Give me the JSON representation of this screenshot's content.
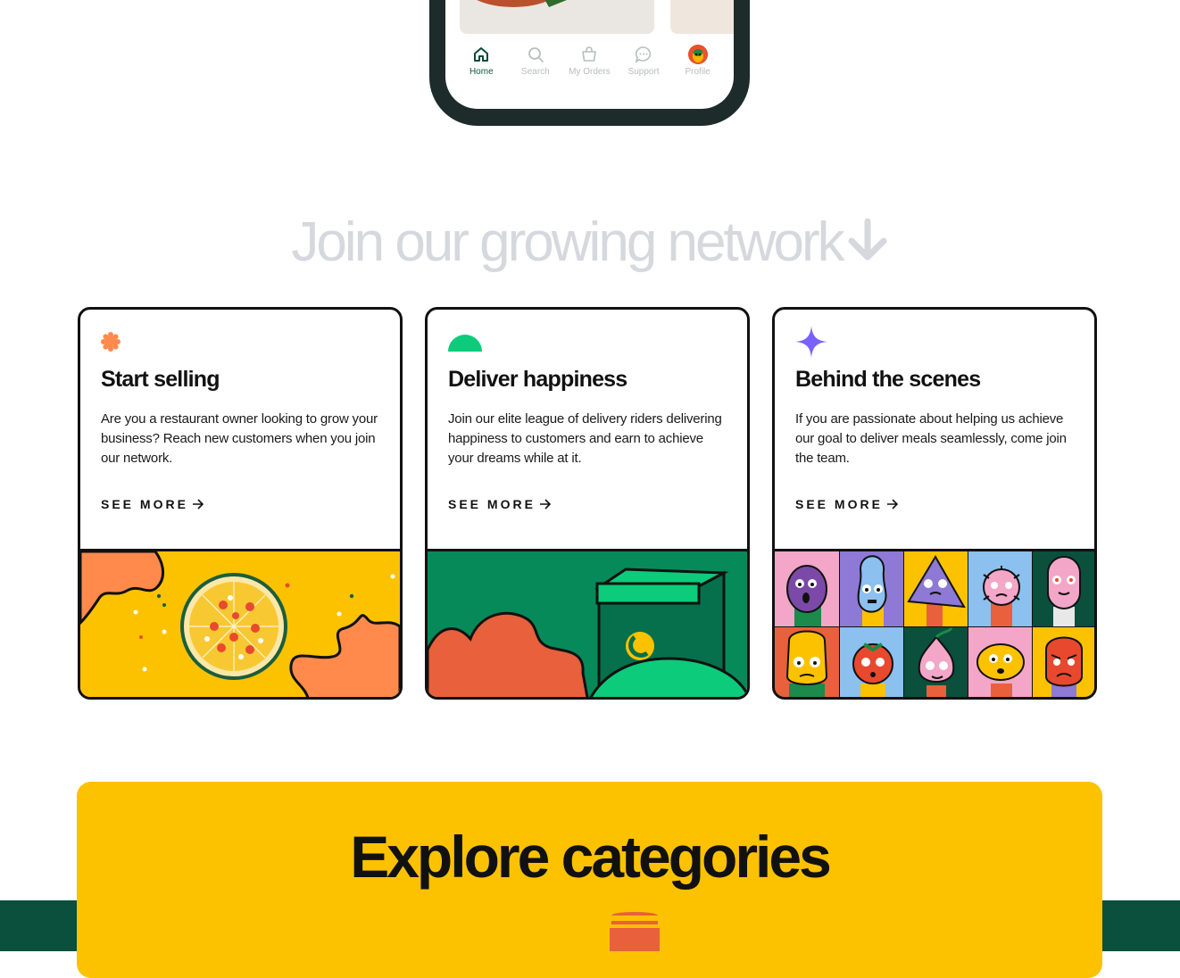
{
  "phone": {
    "nav": [
      {
        "label": "Home",
        "icon": "home-icon",
        "active": true
      },
      {
        "label": "Search",
        "icon": "search-icon",
        "active": false
      },
      {
        "label": "My Orders",
        "icon": "basket-icon",
        "active": false
      },
      {
        "label": "Support",
        "icon": "chat-icon",
        "active": false
      },
      {
        "label": "Profile",
        "icon": "avatar",
        "active": false
      }
    ]
  },
  "network": {
    "title": "Join our growing network",
    "arrow_icon": "arrow-down-icon"
  },
  "cards": [
    {
      "icon": "flower-badge-icon",
      "title": "Start selling",
      "description": "Are you a restaurant owner looking to grow your business? Reach new customers when you join our network.",
      "link": "SEE MORE",
      "illustration": "pizza-illustration"
    },
    {
      "icon": "semicircle-icon",
      "title": "Deliver happiness",
      "description": "Join our elite league of delivery riders delivering happiness to customers and earn to achieve your dreams while at it.",
      "link": "SEE MORE",
      "illustration": "delivery-box-illustration"
    },
    {
      "icon": "sparkle-icon",
      "title": "Behind the scenes",
      "description": "If you are passionate about helping us achieve our goal to deliver meals seamlessly, come join the team.",
      "link": "SEE MORE",
      "illustration": "characters-grid-illustration"
    }
  ],
  "explore": {
    "title": "Explore categories"
  },
  "colors": {
    "brand_green": "#0b4f3d",
    "brand_yellow": "#fcc200",
    "orange": "#ff8a4c",
    "mint": "#0ccb7a",
    "purple": "#7b61ff"
  }
}
